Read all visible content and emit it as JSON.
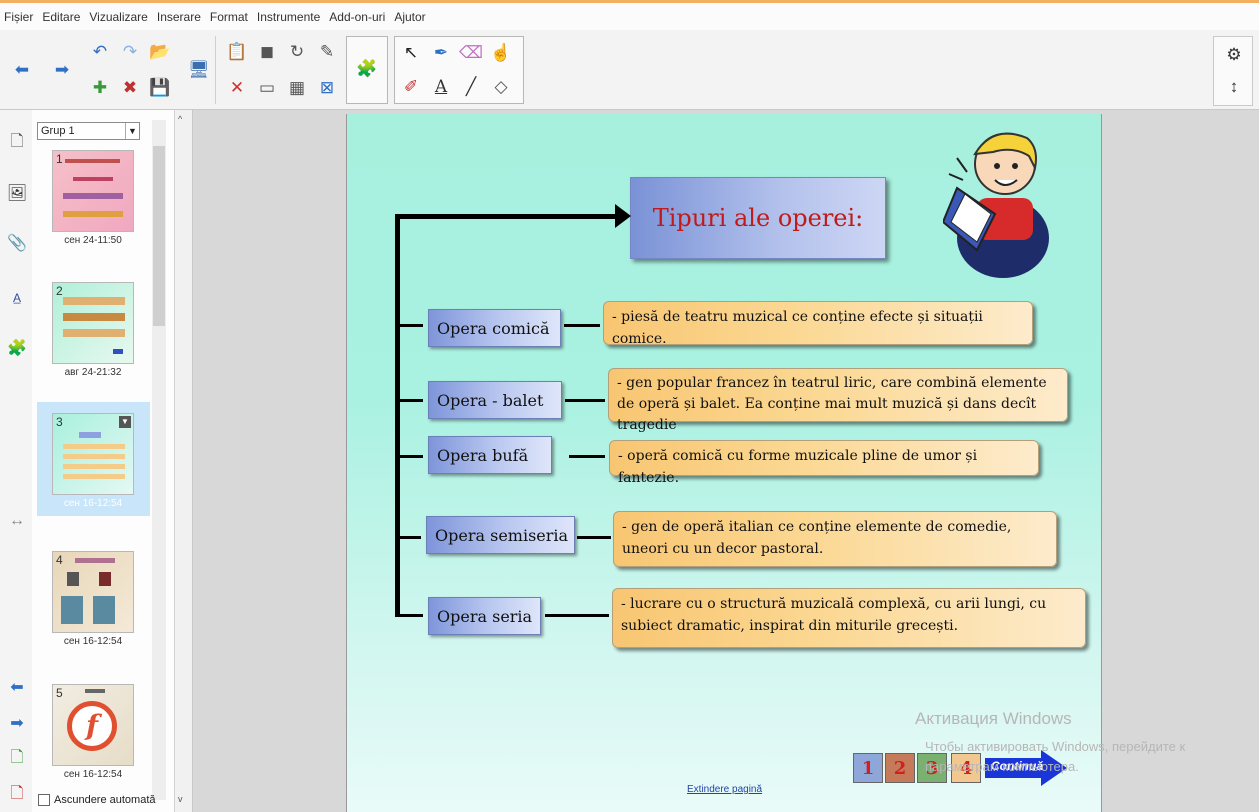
{
  "menu": {
    "items": [
      "Fișier",
      "Editare",
      "Vizualizare",
      "Inserare",
      "Format",
      "Instrumente",
      "Add-on-uri",
      "Ajutor"
    ]
  },
  "sorter": {
    "group_label": "Grup 1",
    "pages": [
      {
        "num": "1",
        "date": "сен 24-11:50"
      },
      {
        "num": "2",
        "date": "авг 24-21:32"
      },
      {
        "num": "3",
        "date": "сен 16-12:54"
      },
      {
        "num": "4",
        "date": "сен 16-12:54"
      },
      {
        "num": "5",
        "date": "сен 16-12:54"
      }
    ],
    "hide_auto_label": "Ascundere automată"
  },
  "slide": {
    "title": "Tipuri ale operei:",
    "types": [
      {
        "name": "Opera comică",
        "desc": "- piesă de teatru muzical ce conține efecte și situații comice."
      },
      {
        "name": "Opera - balet",
        "desc": "- gen popular francez în teatrul liric, care combină elemente de operă și balet. Ea conține mai mult muzică și dans decît tragedie"
      },
      {
        "name": "Opera bufă",
        "desc": "- operă comică cu forme muzicale pline de umor și fantezie."
      },
      {
        "name": "Opera semiseria",
        "desc": "- gen de operă italian ce conține elemente  de comedie, uneori cu un decor pastoral."
      },
      {
        "name": "Opera seria",
        "desc": "- lucrare cu o structură muzicală complexă, cu arii lungi, cu subiect dramatic, inspirat din miturile grecești."
      }
    ],
    "nav": [
      "1",
      "2",
      "3",
      "4"
    ],
    "continue_label": "Continuă",
    "extend_link": "Extindere pagină"
  },
  "watermark": {
    "line1": "Активация Windows",
    "line2": "Чтобы активировать Windows, перейдите к параметрам компьютера."
  },
  "colors": {
    "title_text": "#c01a1a",
    "nav_red": "#d12020",
    "slide_bg": "#a7f0de"
  }
}
